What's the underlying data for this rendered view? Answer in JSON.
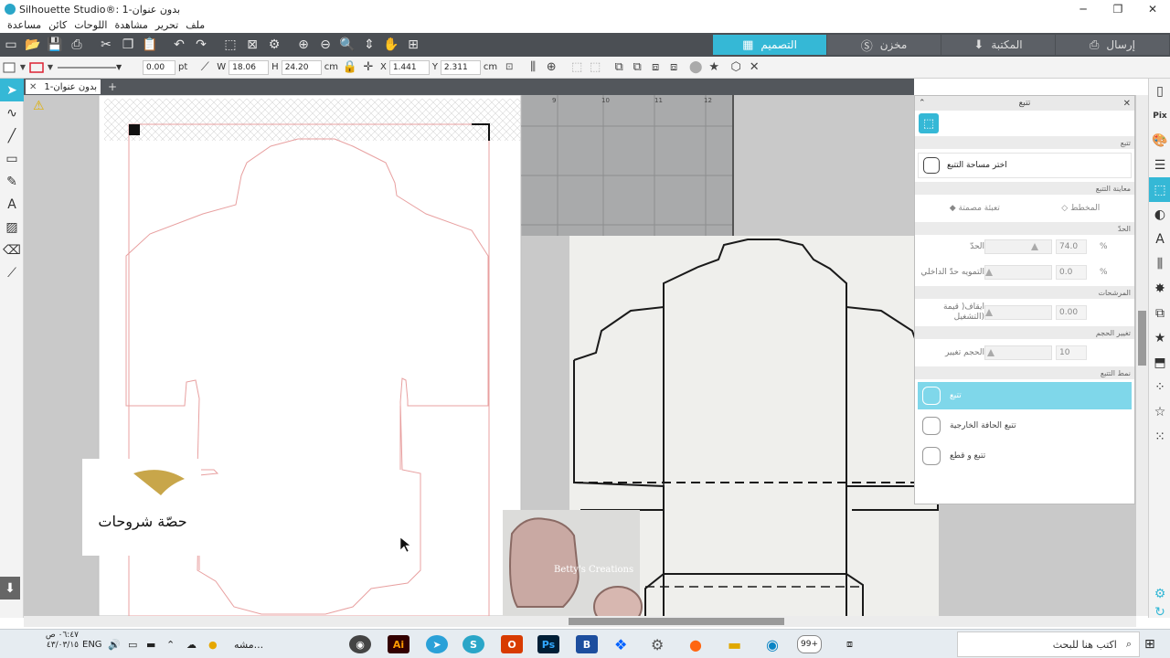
{
  "window": {
    "title": "Silhouette Studio®: بدون عنوان-1",
    "minimize": "─",
    "maximize": "❐",
    "close": "✕"
  },
  "menu": [
    "ملف",
    "تحرير",
    "مشاهدة",
    "اللوحات",
    "كائن",
    "مساعدة"
  ],
  "main_tabs": [
    {
      "label": "التصميم",
      "icon": "grid-icon",
      "active": true
    },
    {
      "label": "مخزن",
      "icon": "store-s-icon",
      "active": false
    },
    {
      "label": "المكتبة",
      "icon": "library-download-icon",
      "active": false
    },
    {
      "label": "إرسال",
      "icon": "send-machine-icon",
      "active": false
    }
  ],
  "toolbar2": {
    "line_width": "0.00",
    "line_unit": "pt",
    "w_label": "W",
    "w_value": "18.06",
    "h_label": "H",
    "h_value": "24.20",
    "size_unit": "cm",
    "x_label": "X",
    "x_value": "1.441",
    "y_label": "Y",
    "y_value": "2.311",
    "pos_unit": "cm"
  },
  "document_tab": {
    "label": "بدون عنوان-1"
  },
  "ruler_labels": [
    "9",
    "10",
    "11",
    "12"
  ],
  "watermark": {
    "text": "Betty's Creations"
  },
  "logo_text": "حصّة شروحات",
  "trace_panel": {
    "title": "تتبع",
    "section_trace": "تتبع",
    "select_area_button": "اختر مساحة التتبع",
    "section_preview": "معاينة التتبع",
    "preview_filled": "تعبئة مصمتة",
    "preview_outline": "المخطط",
    "section_threshold": "الحدّ",
    "threshold_label": "الحدّ",
    "threshold_value": "74.0",
    "threshold_level": 0.74,
    "blur_label": "التمويه حدّ الداخلي",
    "blur_value": "0.0",
    "section_filters": "المرشحات",
    "highpass_label": "ايقاف( قيمة (التشغيل",
    "highpass_value": "0.00",
    "section_scale": "تغيير الحجم",
    "scale_label": "الحجم تغيير",
    "scale_value": "10",
    "unit_percent": "%",
    "section_style": "نمط التتبع",
    "style_trace": "تتبع",
    "style_outer": "تتبع الحافة الخارجية",
    "style_trace_cut": "تتبع و قطع"
  },
  "taskbar": {
    "time": "٠٦:٤٧ ص",
    "date": "٤٣/٠٣/١٥",
    "language": "ENG",
    "active_window": "مشه...",
    "search_placeholder": "اكتب هنا للبحث",
    "notification_badge": "99+"
  },
  "colors": {
    "accent": "#35b8d6",
    "toolbar_dark": "#4b4f54",
    "cut_line": "#e8a0a0"
  }
}
